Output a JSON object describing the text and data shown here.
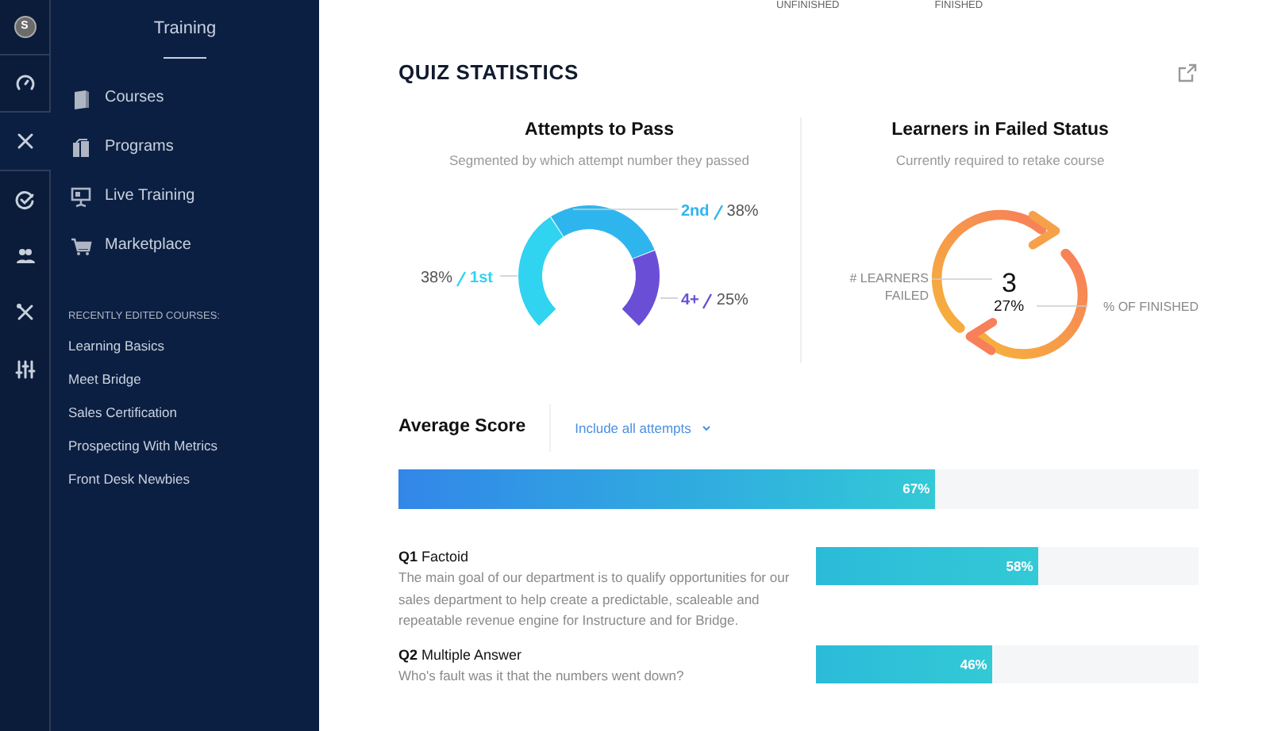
{
  "rail": {
    "avatar_letter": "S"
  },
  "sidebar": {
    "title": "Training",
    "items": [
      {
        "label": "Courses"
      },
      {
        "label": "Programs"
      },
      {
        "label": "Live Training"
      },
      {
        "label": "Marketplace"
      }
    ],
    "recent_heading": "RECENTLY EDITED COURSES:",
    "recent": [
      "Learning Basics",
      "Meet Bridge",
      "Sales Certification",
      "Prospecting With Metrics",
      "Front Desk Newbies"
    ]
  },
  "top_labels": [
    "UNFINISHED",
    "FINISHED"
  ],
  "section_title": "QUIZ STATISTICS",
  "attempts": {
    "subtitle": "Segmented by which attempt number they passed",
    "chart_data": {
      "type": "donut",
      "title": "Attempts to Pass",
      "categories": [
        "1st",
        "2nd",
        "4+"
      ],
      "values": [
        38,
        38,
        25
      ],
      "value_labels": [
        "38%",
        "38%",
        "25%"
      ],
      "data_labels": true,
      "legend": "right"
    }
  },
  "failed": {
    "title": "Learners in Failed Status",
    "subtitle": "Currently required to retake course",
    "count": "3",
    "percent": "27%",
    "count_label": "# LEARNERS FAILED",
    "percent_label": "% OF FINISHED"
  },
  "average": {
    "title": "Average Score",
    "filter": "Include all attempts",
    "level": 0.67,
    "reading": "67%"
  },
  "questions": [
    {
      "number": "Q1",
      "type": "Factoid",
      "text": "The main goal of our department is to qualify opportunities for our sales department to help create a predictable, scaleable and repeatable revenue engine for Instructure and for Bridge.",
      "level": 0.58,
      "reading": "58%"
    },
    {
      "number": "Q2",
      "type": "Multiple Answer",
      "text": "Who's fault was it that the numbers went down?",
      "level": 0.46,
      "reading": "46%"
    }
  ]
}
